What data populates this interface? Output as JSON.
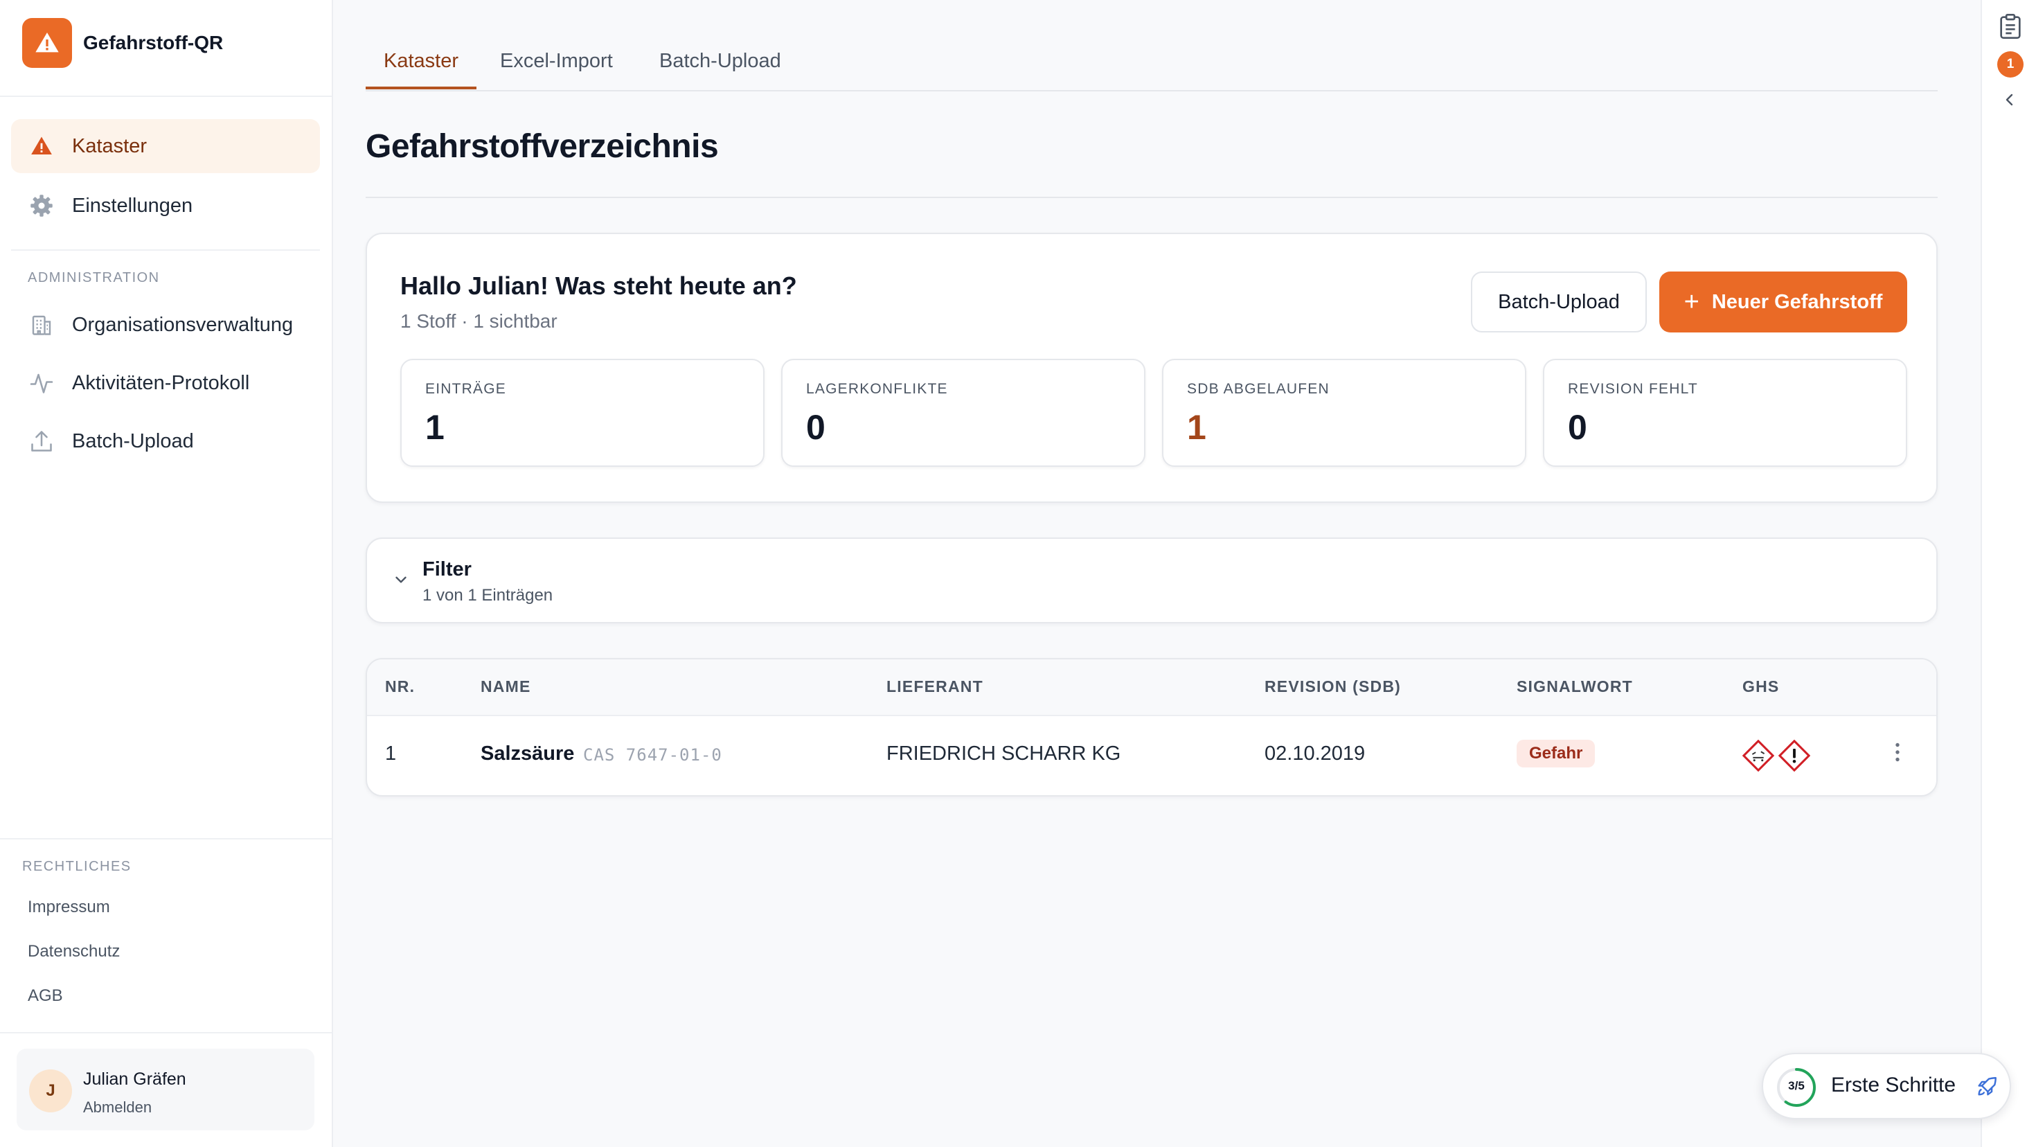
{
  "app": {
    "name": "Gefahrstoff-QR"
  },
  "sidebar": {
    "nav": [
      {
        "label": "Kataster",
        "icon": "warning-triangle-icon",
        "active": true
      },
      {
        "label": "Einstellungen",
        "icon": "gear-icon",
        "active": false
      }
    ],
    "admin_heading": "ADMINISTRATION",
    "admin_items": [
      {
        "label": "Organisationsverwaltung",
        "icon": "building-icon"
      },
      {
        "label": "Aktivitäten-Protokoll",
        "icon": "activity-icon"
      },
      {
        "label": "Batch-Upload",
        "icon": "upload-icon"
      }
    ],
    "legal_heading": "RECHTLICHES",
    "legal_links": [
      "Impressum",
      "Datenschutz",
      "AGB"
    ],
    "user": {
      "initial": "J",
      "name": "Julian Gräfen",
      "logout_label": "Abmelden"
    }
  },
  "tabs": [
    {
      "label": "Kataster",
      "active": true
    },
    {
      "label": "Excel-Import",
      "active": false
    },
    {
      "label": "Batch-Upload",
      "active": false
    }
  ],
  "page": {
    "title": "Gefahrstoffverzeichnis"
  },
  "summary": {
    "greeting": "Hallo Julian! Was steht heute an?",
    "subtitle": "1 Stoff · 1 sichtbar",
    "batch_button": "Batch-Upload",
    "new_button": "Neuer Gefahrstoff",
    "new_button_icon": "+",
    "stats": [
      {
        "label": "EINTRÄGE",
        "value": "1",
        "highlight": false
      },
      {
        "label": "LAGERKONFLIKTE",
        "value": "0",
        "highlight": false
      },
      {
        "label": "SDB ABGELAUFEN",
        "value": "1",
        "highlight": true
      },
      {
        "label": "REVISION FEHLT",
        "value": "0",
        "highlight": false
      }
    ]
  },
  "filter": {
    "title": "Filter",
    "subtitle": "1 von 1 Einträgen"
  },
  "table": {
    "headers": [
      "NR.",
      "NAME",
      "LIEFERANT",
      "REVISION (SDB)",
      "SIGNALWORT",
      "GHS"
    ],
    "rows": [
      {
        "nr": "1",
        "name": "Salzsäure",
        "cas": "CAS 7647-01-0",
        "supplier": "FRIEDRICH SCHARR KG",
        "revision": "02.10.2019",
        "signal_word": "Gefahr",
        "ghs": [
          "ghs05-corrosive-icon",
          "ghs07-exclamation-icon"
        ]
      }
    ]
  },
  "rail": {
    "notification_count": "1"
  },
  "onboarding": {
    "label": "Erste Schritte",
    "progress": "3/5",
    "progress_fraction": 0.6
  },
  "colors": {
    "accent": "#ea6a26",
    "accent_dark": "#8a3a13",
    "danger_bg": "#fde9e5",
    "danger_text": "#9b2c1a",
    "ghs_red": "#d11f26"
  }
}
